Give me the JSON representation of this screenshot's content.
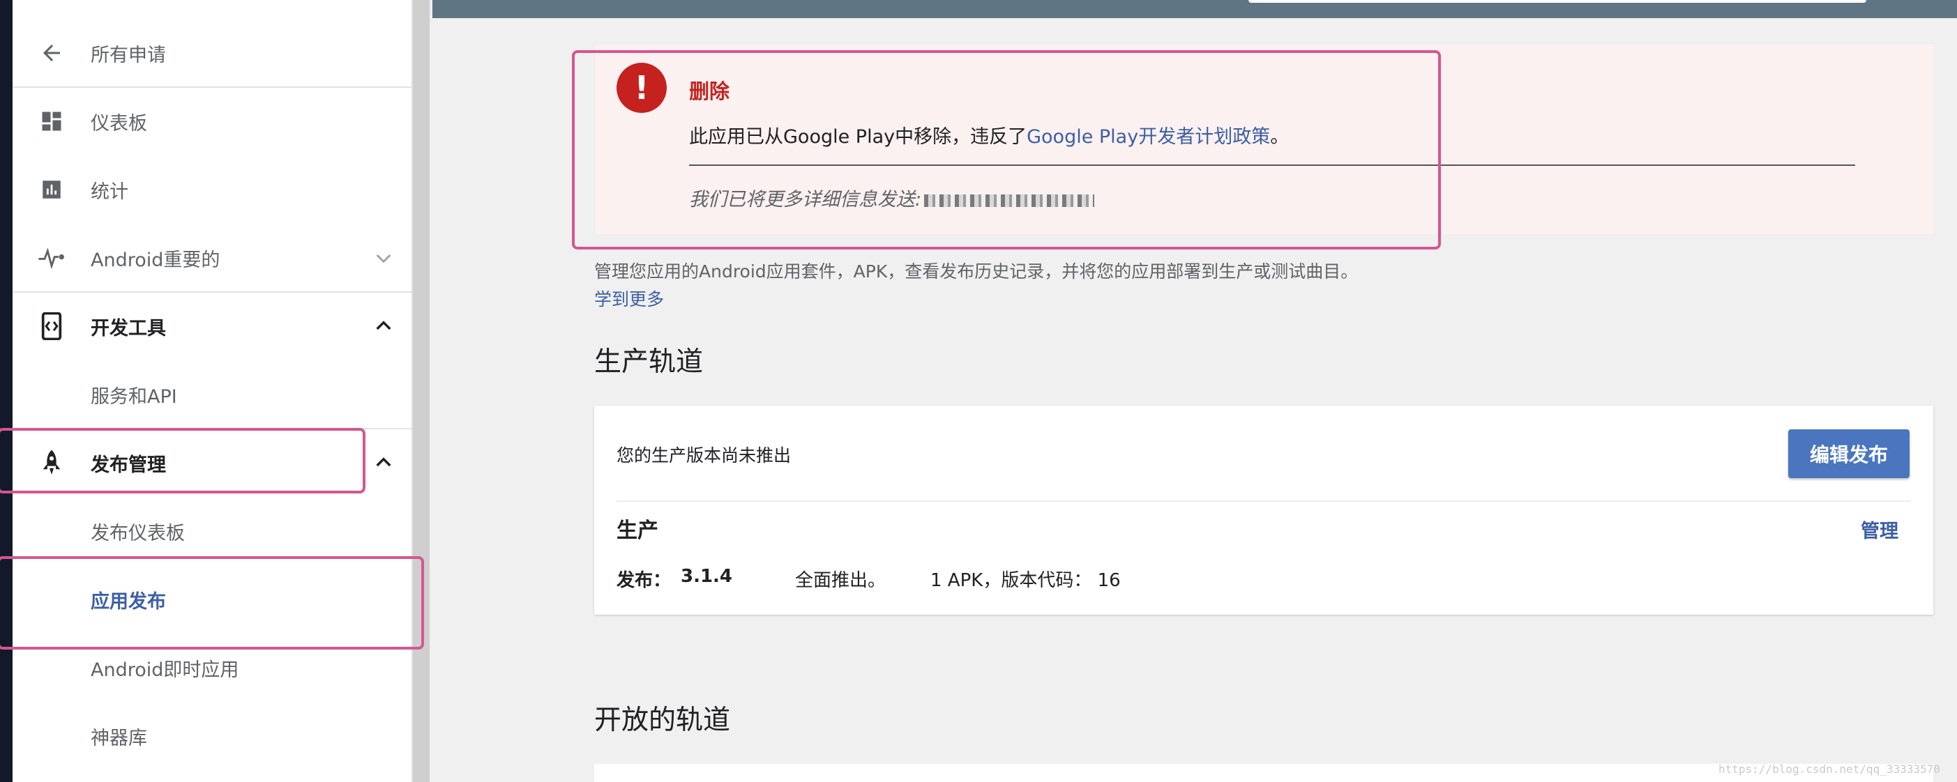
{
  "sidebar": {
    "back_label": "所有申请",
    "items": [
      {
        "label": "仪表板",
        "icon": "dashboard-icon"
      },
      {
        "label": "统计",
        "icon": "bar-chart-icon"
      },
      {
        "label": "Android重要的",
        "icon": "pulse-icon"
      },
      {
        "label": "开发工具",
        "icon": "dev-tools-icon"
      },
      {
        "label": "服务和API"
      },
      {
        "label": "发布管理",
        "icon": "rocket-icon"
      },
      {
        "label": "发布仪表板"
      },
      {
        "label": "应用发布"
      },
      {
        "label": "Android即时应用"
      },
      {
        "label": "神器库"
      }
    ]
  },
  "alert": {
    "title": "删除",
    "body_prefix": "此应用已从Google Play中移除，违反了",
    "body_link": "Google Play开发者计划政策",
    "body_suffix": "。",
    "note": "我们已将更多详细信息发送:"
  },
  "intro": {
    "text": "管理您应用的Android应用套件，APK，查看发布历史记录，并将您的应用部署到生产或测试曲目。",
    "learn_more": "学到更多"
  },
  "production": {
    "section_title": "生产轨道",
    "status": "您的生产版本尚未推出",
    "edit_button": "编辑发布",
    "track_name": "生产",
    "manage_link": "管理",
    "release_label": "发布：",
    "release_version": "3.1.4",
    "rollout": "全面推出。",
    "apk_info": "1 APK，版本代码： 16"
  },
  "open_track": {
    "section_title": "开放的轨道"
  },
  "watermark": "https://blog.csdn.net/qq_33333570",
  "colors": {
    "accent": "#3c5ea6",
    "error": "#c5221f",
    "highlight": "#d6568f",
    "button": "#4a76c0"
  }
}
